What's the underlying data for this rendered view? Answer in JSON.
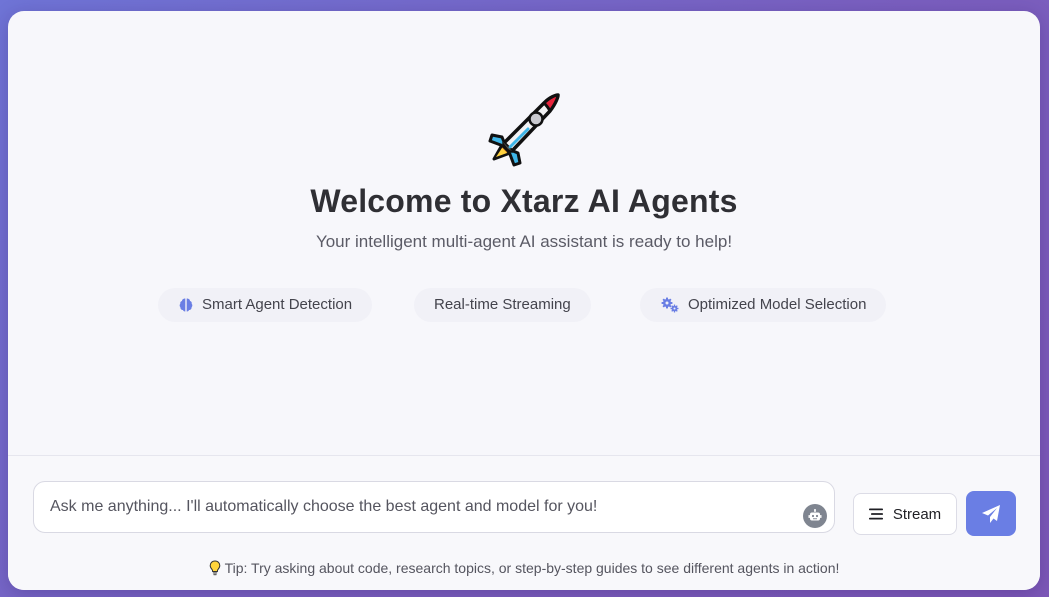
{
  "hero": {
    "icon": "rocket-icon",
    "title": "Welcome to Xtarz AI Agents",
    "subtitle": "Your intelligent multi-agent AI assistant is ready to help!"
  },
  "features": [
    {
      "label": "Smart Agent Detection",
      "icon": "brain-icon"
    },
    {
      "label": "Real-time Streaming",
      "icon": ""
    },
    {
      "label": "Optimized Model Selection",
      "icon": "cogs-icon"
    }
  ],
  "composer": {
    "placeholder": "Ask me anything... I'll automatically choose the best agent and model for you!",
    "value": "",
    "stream_label": "Stream",
    "send_icon": "paper-plane-icon",
    "bot_icon": "robot-icon",
    "tip": "Tip: Try asking about code, research topics, or step-by-step guides to see different agents in action!",
    "tip_icon": "lightbulb-icon"
  },
  "colors": {
    "accent": "#6a7ee4",
    "background_gradient_start": "#6f74d6",
    "background_gradient_end": "#7d58b8",
    "card": "#f7f7fb",
    "title_text": "#2f2f34"
  }
}
